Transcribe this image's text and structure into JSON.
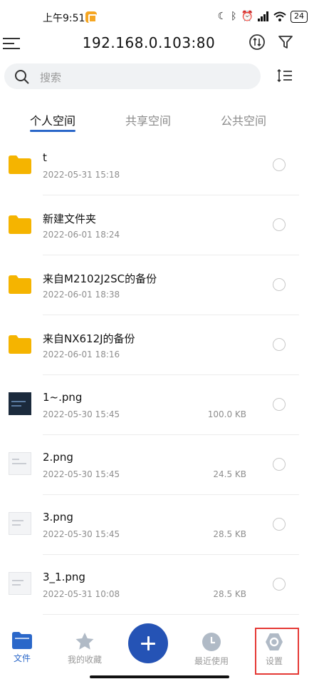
{
  "status_bar": {
    "time": "上午9:51",
    "battery": "24",
    "glyphs": [
      "moon-icon",
      "bluetooth-icon",
      "alarm-icon",
      "signal-icon",
      "wifi-icon"
    ]
  },
  "header": {
    "title": "192.168.0.103:80"
  },
  "search": {
    "placeholder": "搜索"
  },
  "tabs": [
    {
      "label": "个人空间",
      "active": true
    },
    {
      "label": "共享空间",
      "active": false
    },
    {
      "label": "公共空间",
      "active": false
    }
  ],
  "files": [
    {
      "name": "t",
      "date": "2022-05-31 15:18",
      "size": "",
      "type": "folder"
    },
    {
      "name": "新建文件夹",
      "date": "2022-06-01 18:24",
      "size": "",
      "type": "folder"
    },
    {
      "name": "来自M2102J2SC的备份",
      "date": "2022-06-01 18:38",
      "size": "",
      "type": "folder"
    },
    {
      "name": "来自NX612J的备份",
      "date": "2022-06-01 18:16",
      "size": "",
      "type": "folder"
    },
    {
      "name": "1~.png",
      "date": "2022-05-30 15:45",
      "size": "100.0 KB",
      "type": "image"
    },
    {
      "name": "2.png",
      "date": "2022-05-30 15:45",
      "size": "24.5 KB",
      "type": "image"
    },
    {
      "name": "3.png",
      "date": "2022-05-30 15:45",
      "size": "28.5 KB",
      "type": "image"
    },
    {
      "name": "3_1.png",
      "date": "2022-05-31 10:08",
      "size": "28.5 KB",
      "type": "image"
    }
  ],
  "bottom_nav": {
    "files": "文件",
    "favorites": "我的收藏",
    "recent": "最近使用",
    "settings": "设置"
  },
  "colors": {
    "accent": "#2a67c9",
    "fab": "#2553b5",
    "folder": "#f5b400",
    "highlight": "#e53935"
  }
}
